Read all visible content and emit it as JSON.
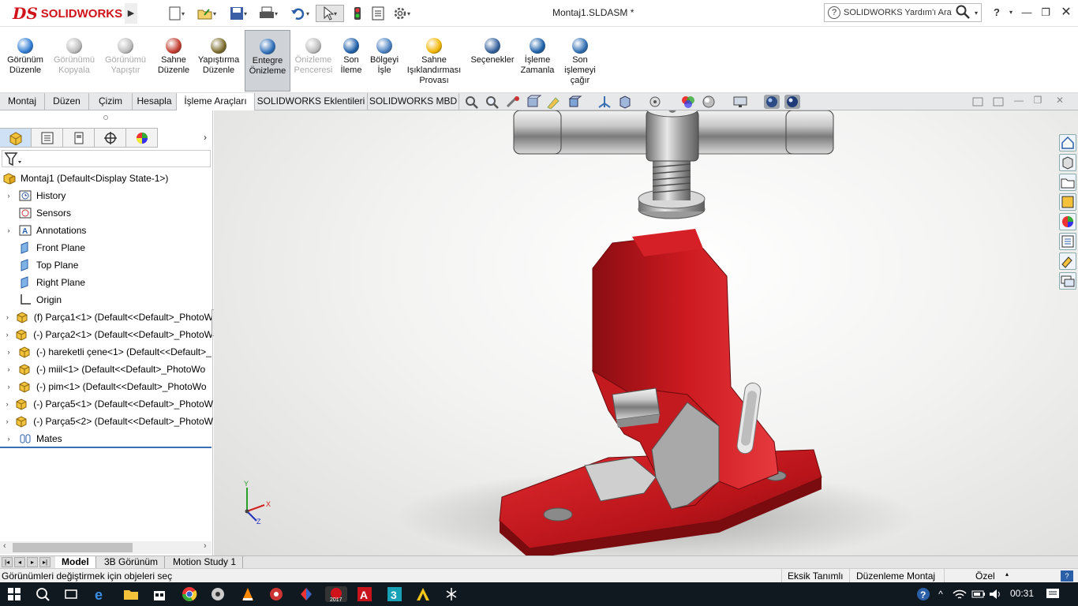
{
  "app": {
    "logo_text": "SOLIDWORKS",
    "document_title": "Montaj1.SLDASM *",
    "help_search_placeholder": "SOLIDWORKS Yardım'ı Ara"
  },
  "colors": {
    "brand_red": "#d0121b",
    "part_red": "#c8161c",
    "ribbon_active": "#cfd3d8",
    "taskbar": "#101820"
  },
  "ribbon": {
    "buttons": [
      {
        "label1": "Görünüm",
        "label2": "Düzenle",
        "enabled": true,
        "icon": "appearance-icon"
      },
      {
        "label1": "Görünümü",
        "label2": "Kopyala",
        "enabled": false,
        "icon": "copy-appearance-icon"
      },
      {
        "label1": "Görünümü",
        "label2": "Yapıştır",
        "enabled": false,
        "icon": "paste-appearance-icon"
      },
      {
        "label1": "Sahne",
        "label2": "Düzenle",
        "enabled": true,
        "icon": "scene-icon"
      },
      {
        "label1": "Yapıştırma",
        "label2": "Düzenle",
        "enabled": true,
        "icon": "decal-icon"
      },
      {
        "label1": "Entegre",
        "label2": "Önizleme",
        "enabled": true,
        "active": true,
        "icon": "integrated-preview-icon"
      },
      {
        "label1": "Önizleme",
        "label2": "Penceresi",
        "enabled": false,
        "icon": "preview-window-icon"
      },
      {
        "label1": "Son",
        "label2": "İleme",
        "enabled": true,
        "icon": "final-render-icon"
      },
      {
        "label1": "Bölgeyi",
        "label2": "İşle",
        "enabled": true,
        "icon": "render-region-icon"
      },
      {
        "label1": "Sahne",
        "label2": "Işıklandırması",
        "label3": "Provası",
        "enabled": true,
        "icon": "scene-illumination-icon"
      },
      {
        "label1": "Seçenekler",
        "label2": "",
        "enabled": true,
        "icon": "options-icon"
      },
      {
        "label1": "İşleme",
        "label2": "Zamanla",
        "enabled": true,
        "icon": "schedule-render-icon"
      },
      {
        "label1": "Son",
        "label2": "işlemeyi",
        "label3": "çağır",
        "enabled": true,
        "icon": "recall-render-icon"
      }
    ]
  },
  "tabs": [
    "Montaj",
    "Düzen",
    "Çizim",
    "Hesapla",
    "İşleme Araçları",
    "SOLIDWORKS Eklentileri",
    "SOLIDWORKS MBD"
  ],
  "selected_tab": "İşleme Araçları",
  "tree": {
    "root": "Montaj1  (Default<Display State-1>)",
    "items": [
      {
        "label": "History",
        "expandable": true,
        "icon": "history-icon"
      },
      {
        "label": "Sensors",
        "expandable": false,
        "icon": "sensors-icon"
      },
      {
        "label": "Annotations",
        "expandable": true,
        "icon": "annotations-icon"
      },
      {
        "label": "Front Plane",
        "expandable": false,
        "icon": "plane-icon"
      },
      {
        "label": "Top Plane",
        "expandable": false,
        "icon": "plane-icon"
      },
      {
        "label": "Right Plane",
        "expandable": false,
        "icon": "plane-icon"
      },
      {
        "label": "Origin",
        "expandable": false,
        "icon": "origin-icon"
      },
      {
        "label": "(f) Parça1<1> (Default<<Default>_PhotoW",
        "expandable": true,
        "icon": "part-icon"
      },
      {
        "label": "(-) Parça2<1> (Default<<Default>_PhotoW",
        "expandable": true,
        "icon": "part-icon"
      },
      {
        "label": "(-) hareketli çene<1> (Default<<Default>_",
        "expandable": true,
        "icon": "part-icon"
      },
      {
        "label": "(-) miil<1> (Default<<Default>_PhotoWo",
        "expandable": true,
        "icon": "part-icon"
      },
      {
        "label": "(-) pim<1> (Default<<Default>_PhotoWo",
        "expandable": true,
        "icon": "part-icon"
      },
      {
        "label": "(-) Parça5<1> (Default<<Default>_PhotoW",
        "expandable": true,
        "icon": "part-icon"
      },
      {
        "label": "(-) Parça5<2> (Default<<Default>_PhotoW",
        "expandable": true,
        "icon": "part-icon"
      },
      {
        "label": "Mates",
        "expandable": true,
        "icon": "mates-icon"
      }
    ]
  },
  "triad": {
    "x": "X",
    "y": "Y",
    "z": "Z"
  },
  "bottom_tabs": [
    "Model",
    "3B Görünüm",
    "Motion Study 1"
  ],
  "status": {
    "message": "Görünümleri değiştirmek için objeleri seç",
    "definition": "Eksik Tanımlı",
    "mode": "Düzenleme Montaj",
    "units": "Özel"
  },
  "taskbar": {
    "clock": "00:31"
  }
}
